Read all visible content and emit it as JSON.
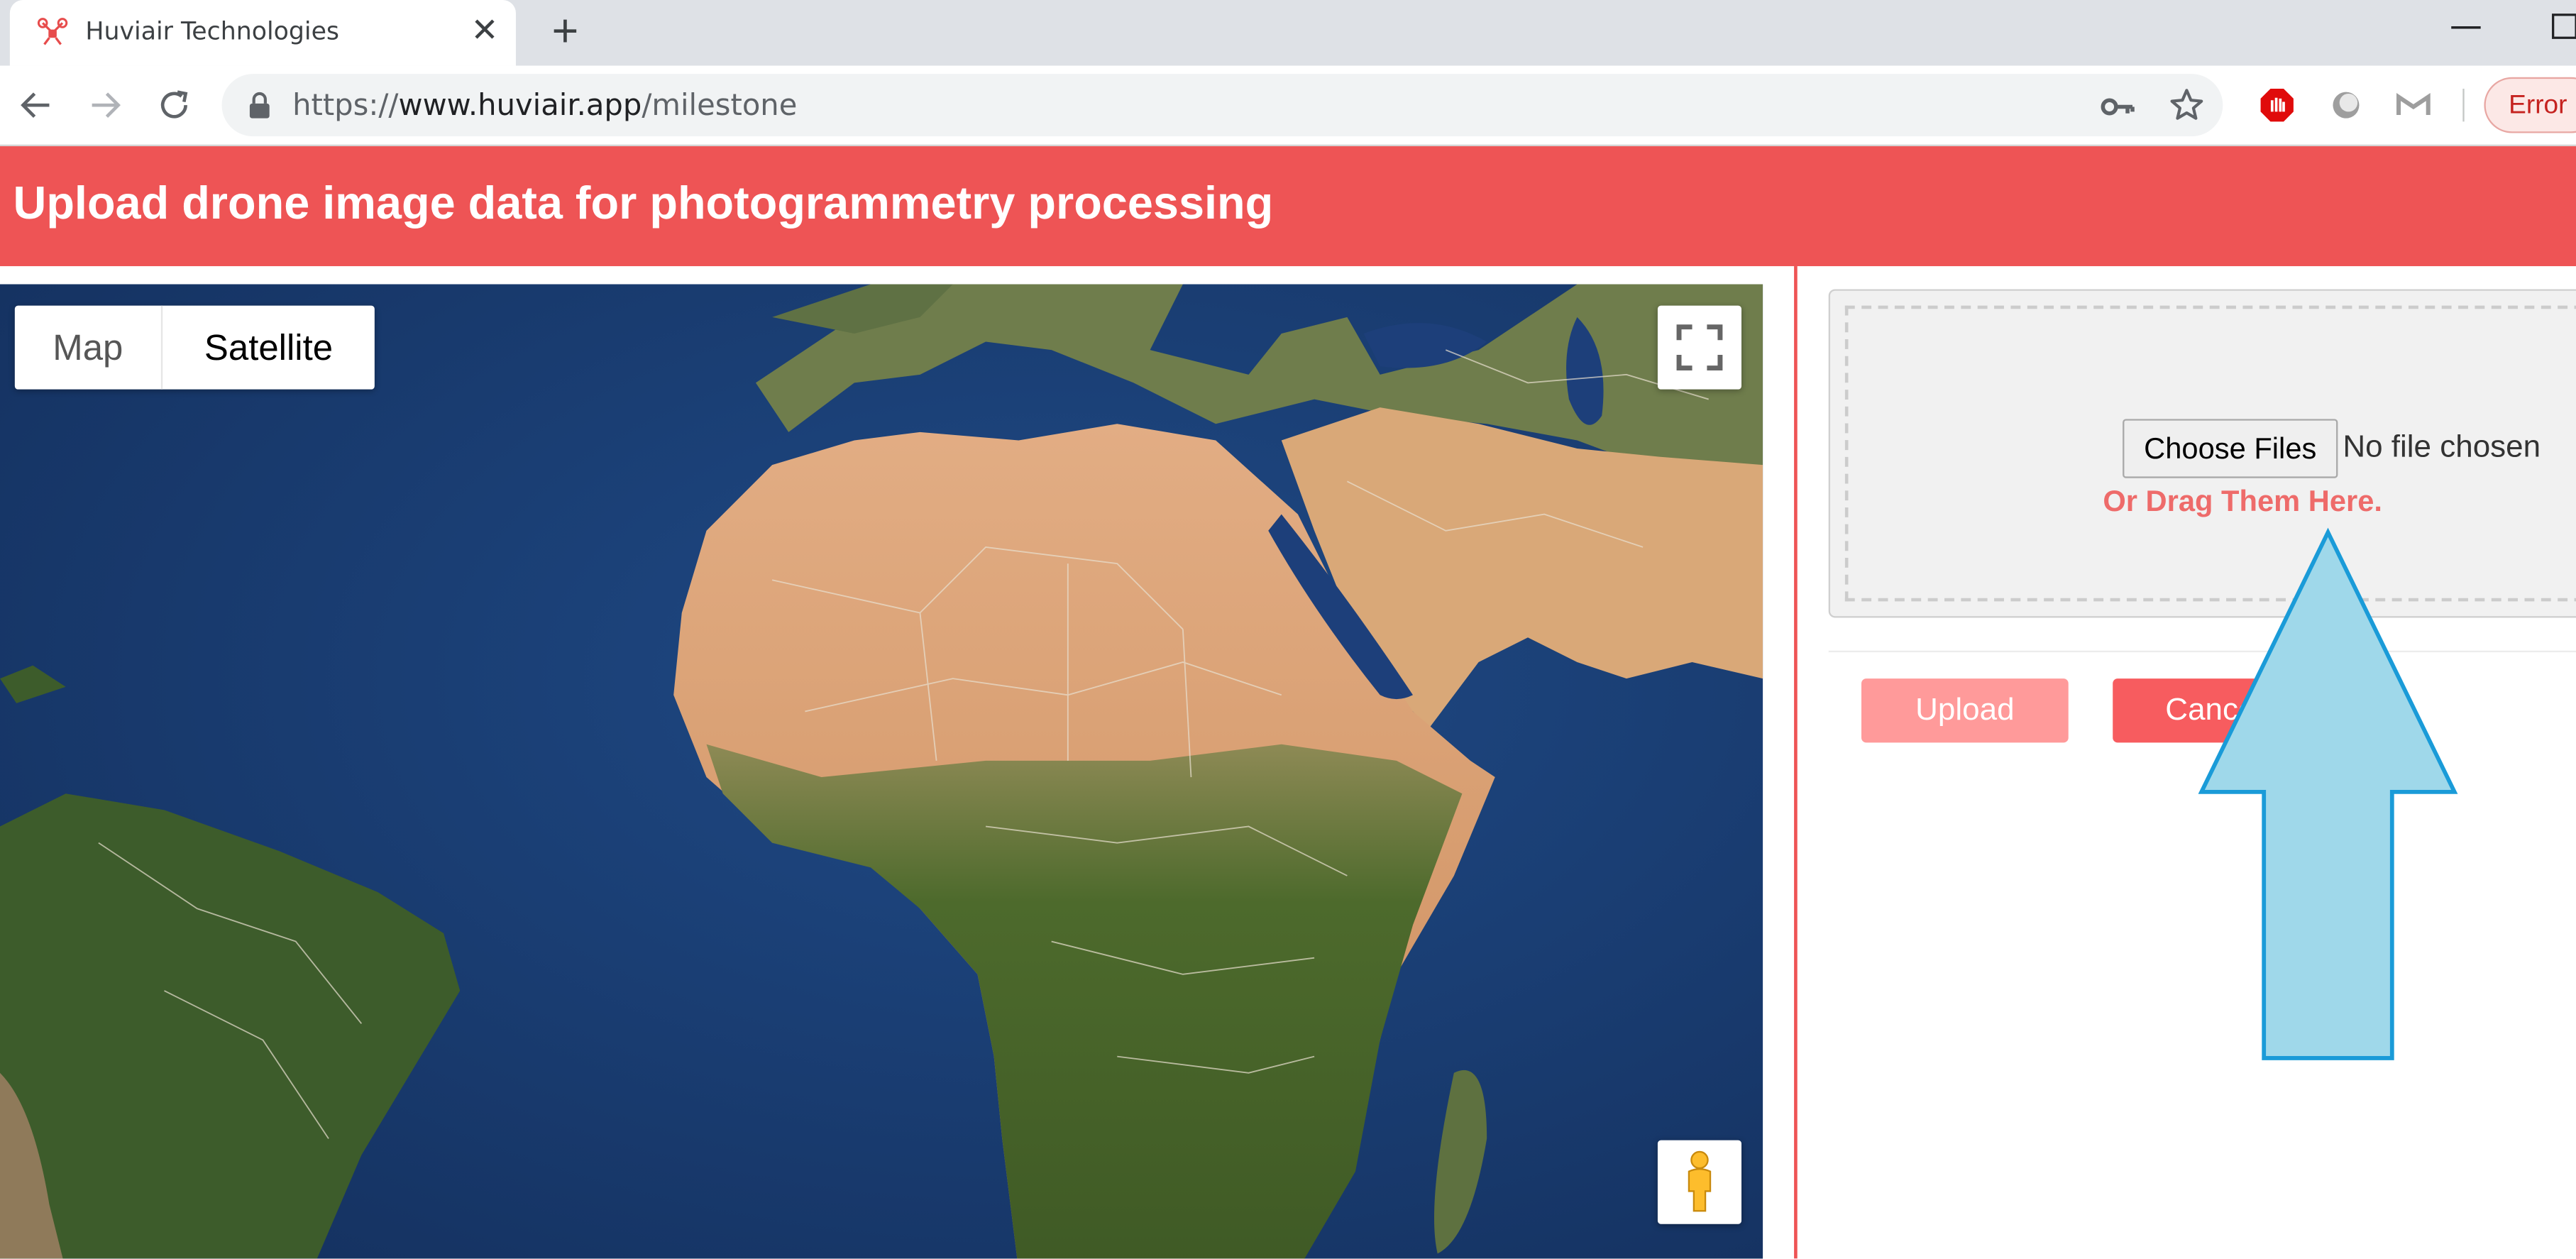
{
  "browser": {
    "tab_title": "Huviair Technologies",
    "tab_close": "✕",
    "new_tab": "+",
    "url_scheme": "https://",
    "url_host": "www.huviair.app",
    "url_path": "/milestone",
    "error_label": "Error"
  },
  "header": {
    "title": "Upload drone image data for photogrammetry processing"
  },
  "map": {
    "type_map_label": "Map",
    "type_satellite_label": "Satellite",
    "selected_type": "Satellite"
  },
  "upload": {
    "choose_files_label": "Choose Files",
    "no_file_text": "No file chosen",
    "drag_text": "Or Drag Them Here.",
    "upload_label": "Upload",
    "cancel_label": "Cancel"
  },
  "colors": {
    "brand": "#ee5455",
    "upload_disabled": "#ff9a9a",
    "cancel": "#f75c5f",
    "annotation_arrow": "#9fd8ea"
  },
  "icons": [
    "drone-favicon-icon",
    "close-icon",
    "plus-icon",
    "back-icon",
    "forward-icon",
    "reload-icon",
    "lock-icon",
    "key-icon",
    "star-icon",
    "stop-extension-icon",
    "circle-extension-icon",
    "mail-extension-icon",
    "fullscreen-icon",
    "pegman-icon",
    "arrow-up-annotation"
  ]
}
